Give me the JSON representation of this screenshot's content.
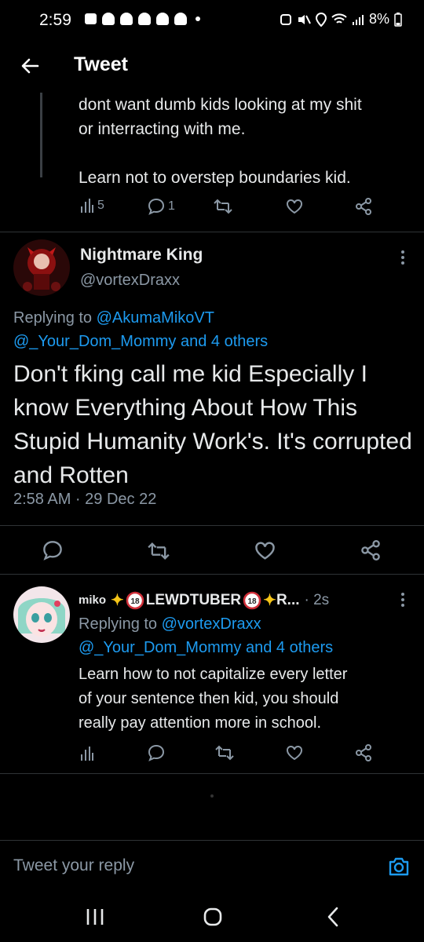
{
  "status_bar": {
    "time": "2:59",
    "battery": "8%"
  },
  "header": {
    "title": "Tweet"
  },
  "prev_tweet": {
    "text": "dont want dumb kids looking at my shit\nor interracting with me.\n\nLearn not to overstep boundaries kid.",
    "views": "5",
    "replies": "1"
  },
  "main_tweet": {
    "name": "Nightmare King",
    "handle": "@vortexDraxx",
    "replying_prefix": "Replying to ",
    "replying_user": "@AkumaMikoVT",
    "replying_others": "@_Your_Dom_Mommy and 4 others",
    "text": "Don't fking call me kid Especially I know Everything About How This Stupid Humanity Work's. It's corrupted and Rotten",
    "timestamp": "2:58 AM · 29 Dec 22"
  },
  "reply_tweet": {
    "name_prefix": "miko ",
    "name_tag": "LEWDTUBER",
    "name_suffix": " R...",
    "age": "· 2s",
    "replying_prefix": "Replying to ",
    "replying_user": "@vortexDraxx",
    "replying_others": "@_Your_Dom_Mommy and 4 others",
    "text": "Learn how to not capitalize every letter\nof your sentence then kid, you should\nreally pay attention more in school."
  },
  "reply_box": {
    "placeholder": "Tweet your reply"
  },
  "colors": {
    "background": "#000000",
    "accent": "#1d9bf0",
    "muted": "#8b98a5",
    "divider": "#2f3336"
  }
}
